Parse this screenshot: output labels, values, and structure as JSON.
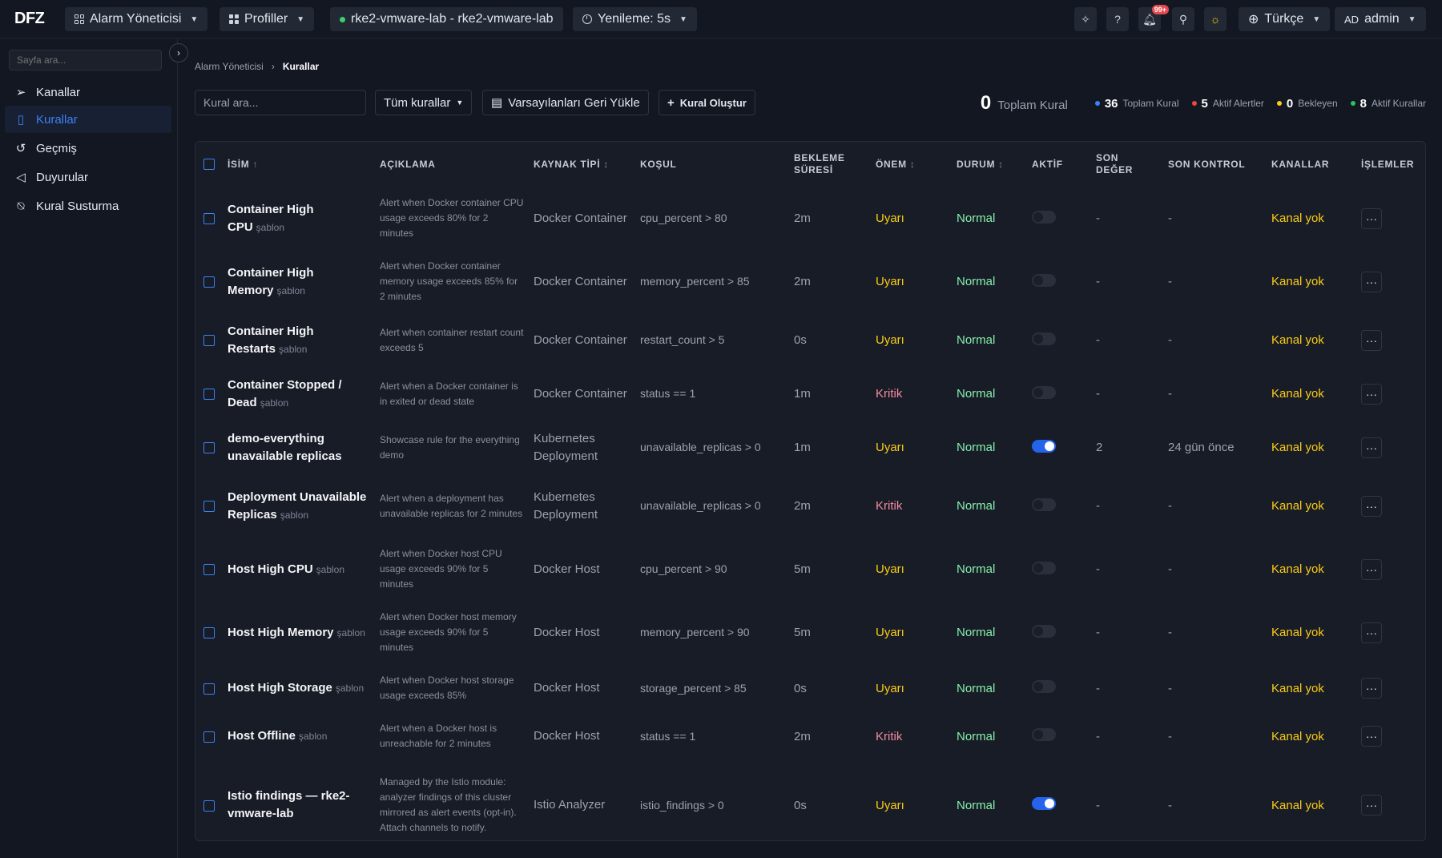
{
  "app": {
    "logo": "DFZ"
  },
  "topbar": {
    "module_label": "Alarm Yöneticisi",
    "profiles_label": "Profiller",
    "cluster_label": "rke2-vmware-lab - rke2-vmware-lab",
    "refresh_label": "Yenileme: 5s",
    "notifications_badge": "99+",
    "language_label": "Türkçe",
    "user_initials": "AD",
    "user_name": "admin"
  },
  "sidebar": {
    "search_placeholder": "Sayfa ara...",
    "items": [
      {
        "label": "Kanallar",
        "icon": "send-icon",
        "active": false
      },
      {
        "label": "Kurallar",
        "icon": "bookmark-icon",
        "active": true
      },
      {
        "label": "Geçmiş",
        "icon": "history-icon",
        "active": false
      },
      {
        "label": "Duyurular",
        "icon": "megaphone-icon",
        "active": false
      },
      {
        "label": "Kural Susturma",
        "icon": "bell-off-icon",
        "active": false
      }
    ]
  },
  "breadcrumb": {
    "parent": "Alarm Yöneticisi",
    "current": "Kurallar"
  },
  "toolbar": {
    "search_placeholder": "Kural ara...",
    "filter_label": "Tüm kurallar",
    "restore_label": "Varsayılanları Geri Yükle",
    "create_label": "Kural Oluştur"
  },
  "stats": {
    "total_value": "0",
    "total_label": "Toplam Kural",
    "items": [
      {
        "value": "36",
        "label": "Toplam Kural",
        "color": "#3b82f6"
      },
      {
        "value": "5",
        "label": "Aktif Alertler",
        "color": "#ef4444"
      },
      {
        "value": "0",
        "label": "Bekleyen",
        "color": "#facc15"
      },
      {
        "value": "8",
        "label": "Aktif Kurallar",
        "color": "#22c55e"
      }
    ]
  },
  "table": {
    "columns": {
      "name": "İSİM",
      "description": "AÇIKLAMA",
      "source_type": "KAYNAK TİPİ",
      "condition": "KOŞUL",
      "wait_1": "BEKLEME",
      "wait_2": "SÜRESİ",
      "severity": "ÖNEM",
      "status": "DURUM",
      "active": "AKTİF",
      "last_value_1": "SON",
      "last_value_2": "DEĞER",
      "last_check": "SON KONTROL",
      "channels": "KANALLAR",
      "actions": "İŞLEMLER"
    },
    "rows": [
      {
        "name": "Container High CPU",
        "template": "şablon",
        "description": "Alert when Docker container CPU usage exceeds 80% for 2 minutes",
        "source": "Docker Container",
        "condition": "cpu_percent > 80",
        "wait": "2m",
        "severity": "Uyarı",
        "severity_level": "warn",
        "status": "Normal",
        "active": false,
        "last_value": "-",
        "last_check": "-",
        "channels": "Kanal yok"
      },
      {
        "name": "Container High Memory",
        "template": "şablon",
        "description": "Alert when Docker container memory usage exceeds 85% for 2 minutes",
        "source": "Docker Container",
        "condition": "memory_percent > 85",
        "wait": "2m",
        "severity": "Uyarı",
        "severity_level": "warn",
        "status": "Normal",
        "active": false,
        "last_value": "-",
        "last_check": "-",
        "channels": "Kanal yok"
      },
      {
        "name": "Container High Restarts",
        "template": "şablon",
        "description": "Alert when container restart count exceeds 5",
        "source": "Docker Container",
        "condition": "restart_count > 5",
        "wait": "0s",
        "severity": "Uyarı",
        "severity_level": "warn",
        "status": "Normal",
        "active": false,
        "last_value": "-",
        "last_check": "-",
        "channels": "Kanal yok"
      },
      {
        "name": "Container Stopped / Dead",
        "template": "şablon",
        "description": "Alert when a Docker container is in exited or dead state",
        "source": "Docker Container",
        "condition": "status == 1",
        "wait": "1m",
        "severity": "Kritik",
        "severity_level": "crit",
        "status": "Normal",
        "active": false,
        "last_value": "-",
        "last_check": "-",
        "channels": "Kanal yok"
      },
      {
        "name": "demo-everything unavailable replicas",
        "template": "",
        "description": "Showcase rule for the everything demo",
        "source": "Kubernetes Deployment",
        "condition": "unavailable_replicas > 0",
        "wait": "1m",
        "severity": "Uyarı",
        "severity_level": "warn",
        "status": "Normal",
        "active": true,
        "last_value": "2",
        "last_check": "24 gün önce",
        "channels": "Kanal yok"
      },
      {
        "name": "Deployment Unavailable Replicas",
        "template": "şablon",
        "description": "Alert when a deployment has unavailable replicas for 2 minutes",
        "source": "Kubernetes Deployment",
        "condition": "unavailable_replicas > 0",
        "wait": "2m",
        "severity": "Kritik",
        "severity_level": "crit",
        "status": "Normal",
        "active": false,
        "last_value": "-",
        "last_check": "-",
        "channels": "Kanal yok"
      },
      {
        "name": "Host High CPU",
        "template": "şablon",
        "description": "Alert when Docker host CPU usage exceeds 90% for 5 minutes",
        "source": "Docker Host",
        "condition": "cpu_percent > 90",
        "wait": "5m",
        "severity": "Uyarı",
        "severity_level": "warn",
        "status": "Normal",
        "active": false,
        "last_value": "-",
        "last_check": "-",
        "channels": "Kanal yok"
      },
      {
        "name": "Host High Memory",
        "template": "şablon",
        "description": "Alert when Docker host memory usage exceeds 90% for 5 minutes",
        "source": "Docker Host",
        "condition": "memory_percent > 90",
        "wait": "5m",
        "severity": "Uyarı",
        "severity_level": "warn",
        "status": "Normal",
        "active": false,
        "last_value": "-",
        "last_check": "-",
        "channels": "Kanal yok"
      },
      {
        "name": "Host High Storage",
        "template": "şablon",
        "description": "Alert when Docker host storage usage exceeds 85%",
        "source": "Docker Host",
        "condition": "storage_percent > 85",
        "wait": "0s",
        "severity": "Uyarı",
        "severity_level": "warn",
        "status": "Normal",
        "active": false,
        "last_value": "-",
        "last_check": "-",
        "channels": "Kanal yok"
      },
      {
        "name": "Host Offline",
        "template": "şablon",
        "description": "Alert when a Docker host is unreachable for 2 minutes",
        "source": "Docker Host",
        "condition": "status == 1",
        "wait": "2m",
        "severity": "Kritik",
        "severity_level": "crit",
        "status": "Normal",
        "active": false,
        "last_value": "-",
        "last_check": "-",
        "channels": "Kanal yok"
      },
      {
        "name": "Istio findings — rke2-vmware-lab",
        "template": "",
        "description": "Managed by the Istio module: analyzer findings of this cluster mirrored as alert events (opt-in). Attach channels to notify.",
        "source": "Istio Analyzer",
        "condition": "istio_findings > 0",
        "wait": "0s",
        "severity": "Uyarı",
        "severity_level": "warn",
        "status": "Normal",
        "active": true,
        "last_value": "-",
        "last_check": "-",
        "channels": "Kanal yok"
      }
    ]
  },
  "more_glyph": "···"
}
